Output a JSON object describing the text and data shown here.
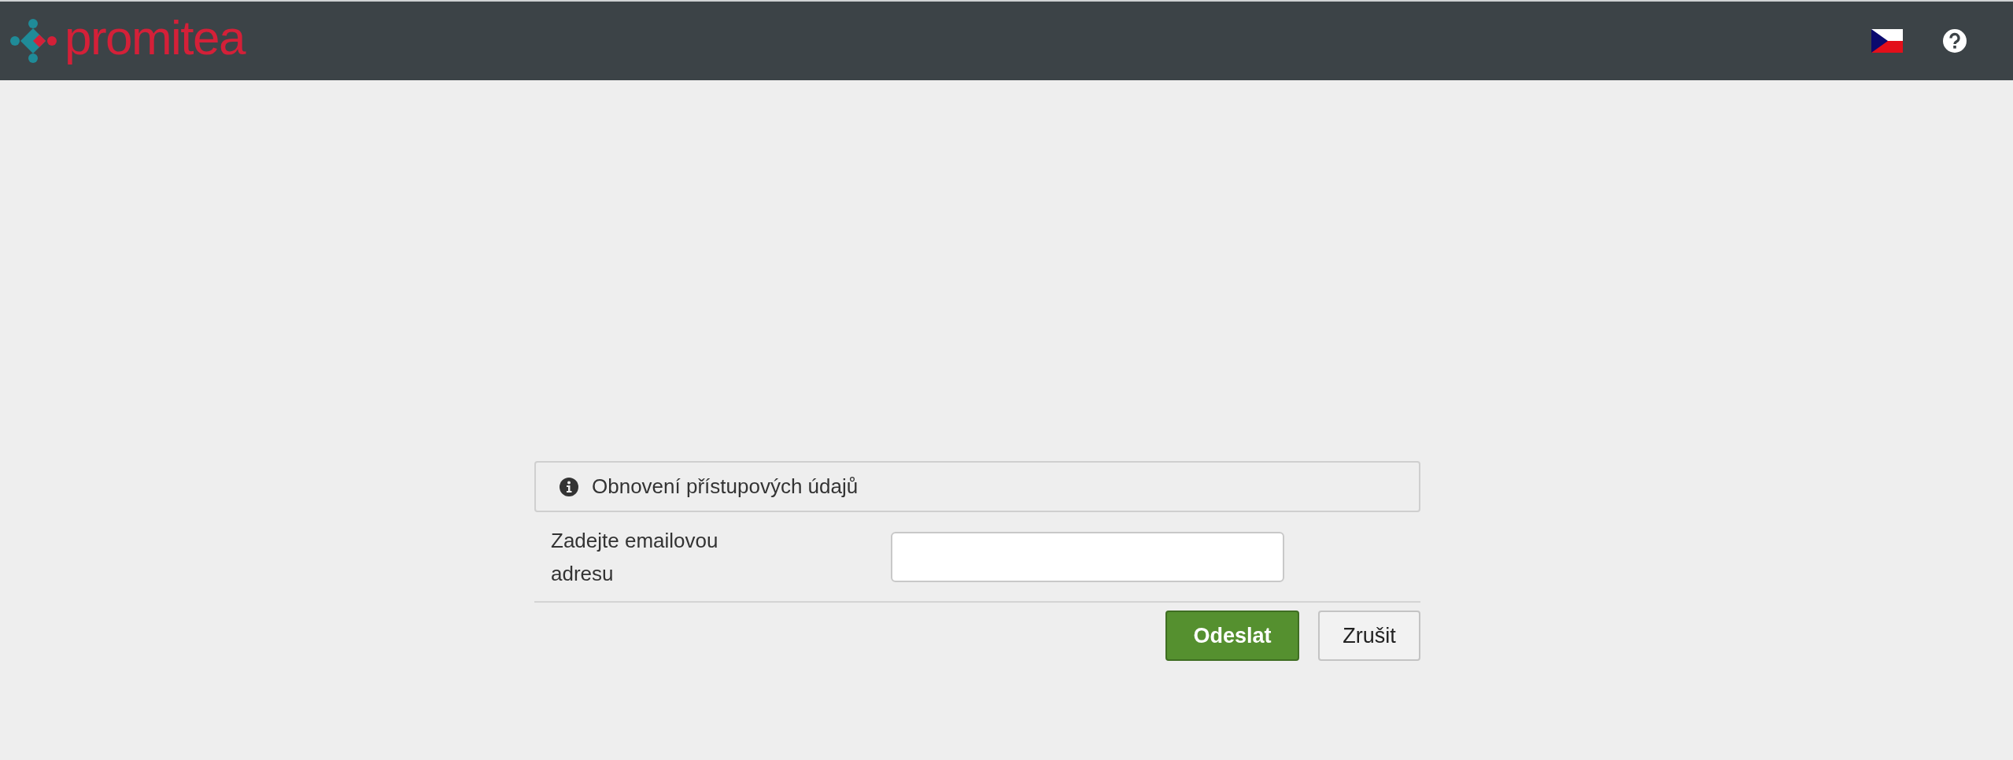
{
  "header": {
    "logo_text": "promitea"
  },
  "panel": {
    "title": "Obnovení přístupových údajů"
  },
  "form": {
    "label": "Zadejte emailovou adresu"
  },
  "buttons": [
    {
      "label": "Odeslat",
      "kind": "primary"
    },
    {
      "label": "Zrušit",
      "kind": "secondary"
    }
  ]
}
